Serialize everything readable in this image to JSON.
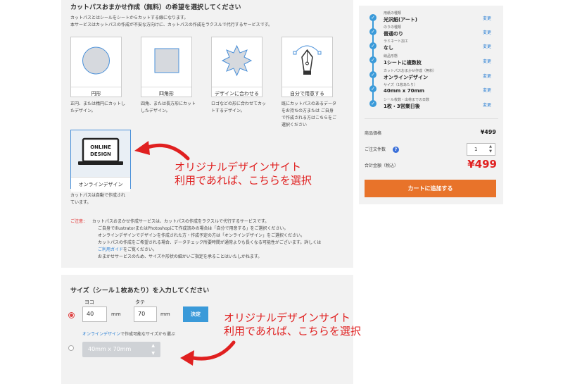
{
  "section_title": "カットパスおまかせ作成（無料）の希望を選択してください",
  "intro_lines": [
    "カットパスとはシールをシートからカットする線になります。",
    "本サービスはカットパスの作成が不安な方向けに、カットパスの作成をラクスルで代行するサービスです。"
  ],
  "options": [
    {
      "label": "円形",
      "desc": [
        "正円、または楕円にカットし",
        "たデザイン。"
      ]
    },
    {
      "label": "四角形",
      "desc": [
        "四角、または長方形にカット",
        "したデザイン。"
      ]
    },
    {
      "label": "デザインに合わせる",
      "desc": [
        "ロゴなどの形に合わせてカッ",
        "トするデザイン。"
      ]
    },
    {
      "label": "自分で用意する",
      "desc": [
        "既にカットパスのあるデータ",
        "をお持ちの方または ご自身",
        "で作成される方はこちらをご",
        "選択ください"
      ]
    }
  ],
  "online_card": {
    "screen_line1": "ONLINE",
    "screen_line2": "DESIGN",
    "label": "オンラインデザイン",
    "desc": [
      "カットパスは自動で作成され",
      "ています。"
    ]
  },
  "annotation_1": [
    "オリジナルデザインサイト",
    "利用であれば、こちらを選択"
  ],
  "annotation_2": [
    "オリジナルデザインサイト",
    "利用であれば、こちらを選択"
  ],
  "notice": {
    "label": "ご注意：",
    "lines": [
      "カットパスおまかせ作成サービスは、カットパスの作成をラクスルで代行するサービスです。",
      "ご自身でIllustratorまたはPhotoshopにて作成済みの場合は「自分で用意する」をご選択ください。",
      "オンラインデザインでデザインを作成された方・作成予定の方は「オンラインデザイン」をご選択ください。",
      "カットパスの作成をご希望される場合、データチェック所要時間が通常よりも長くなる可能性がございます。詳しくは",
      "をご覧ください。",
      "おまかせサービスのため、サイズや形状の細かいご指定を承ることはいたしかねます。"
    ],
    "link": "ご利用ガイド"
  },
  "size": {
    "title": "サイズ（シール１枚あたり）を入力してください",
    "width_label": "ヨコ",
    "height_label": "タテ",
    "width_value": "40",
    "height_value": "70",
    "unit": "mm",
    "confirm": "決定",
    "online_link": "オンラインデザイン",
    "online_note": "で作成可能なサイズから選ぶ",
    "select_value": "40mm x 70mm"
  },
  "summary": {
    "steps": [
      {
        "label": "用紙の種類",
        "value": "光沢紙(アート)"
      },
      {
        "label": "のりの種類",
        "value": "普通のり"
      },
      {
        "label": "ラミネート加工",
        "value": "なし"
      },
      {
        "label": "納品形態",
        "value": "1シートに複数枚"
      },
      {
        "label": "カットパスおまかせ作成（無料）",
        "value": "オンラインデザイン"
      },
      {
        "label": "サイズ（1枚あたり）",
        "value": "40mm x 70mm"
      },
      {
        "label": "シール枚数・出荷までの日数",
        "value": "1枚・3営業日後"
      }
    ],
    "change_label": "変更",
    "price_label": "商品価格",
    "price_value": "¥499",
    "qty_label": "ご注文件数",
    "qty_value": "1",
    "help_icon": "?",
    "total_label": "合計金額（税込）",
    "total_value": "¥499",
    "cart_button": "カートに追加する"
  },
  "colors": {
    "accent": "#3a9ad9",
    "cart": "#e8732a",
    "annotation": "#e02020",
    "panel": "#f2f2f2"
  }
}
